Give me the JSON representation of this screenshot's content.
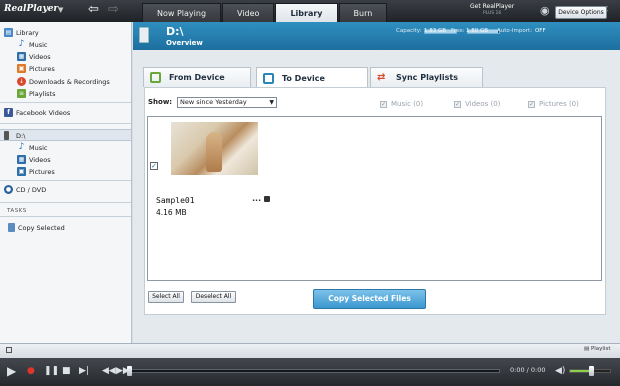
{
  "app": {
    "logo_text": "RealPlayer"
  },
  "tabs": [
    {
      "label": "Now Playing"
    },
    {
      "label": "Video"
    },
    {
      "label": "Library"
    },
    {
      "label": "Burn"
    }
  ],
  "get_realplayer": {
    "line1": "Get RealPlayer",
    "line2": "PLUS 16"
  },
  "sidebar": {
    "library": "Library",
    "library_items": [
      "Music",
      "Videos",
      "Pictures",
      "Downloads & Recordings",
      "Playlists"
    ],
    "facebook": "Facebook Videos",
    "device": "D:\\",
    "device_items": [
      "Music",
      "Videos",
      "Pictures"
    ],
    "cd": "CD / DVD",
    "tasks_head": "TASKS",
    "task_items": [
      "Copy Selected"
    ]
  },
  "header": {
    "device_title": "D:\\",
    "subtitle": "Overview",
    "capacity_label": "Capacity:",
    "capacity_value": "1.83 GB",
    "free_label": "Free:",
    "free_value": "1.80 GB",
    "free_fraction": 0.98,
    "auto_import_label": "Auto-Import:",
    "auto_import_value": "OFF",
    "device_options": "Device Options"
  },
  "panel_tabs": [
    {
      "label": "From Device"
    },
    {
      "label": "To Device"
    },
    {
      "label": "Sync Playlists"
    }
  ],
  "filter": {
    "show_label": "Show:",
    "show_value": "New since Yesterday",
    "music": "Music (0)",
    "videos": "Videos (0)",
    "pictures": "Pictures (0)"
  },
  "file": {
    "name": "Sample01",
    "size": "4.16 MB",
    "more": "..."
  },
  "buttons": {
    "select_all": "Select All",
    "deselect_all": "Deselect All",
    "copy_selected": "Copy Selected Files"
  },
  "statusbar": {
    "playlist": "Playlist"
  },
  "player": {
    "time": "0:00 / 0:00",
    "volume_fraction": 0.55
  },
  "colors": {
    "accent": "#2a86b8",
    "header_bg": "#1d6f9f",
    "copy_button": "#3b97cf"
  }
}
